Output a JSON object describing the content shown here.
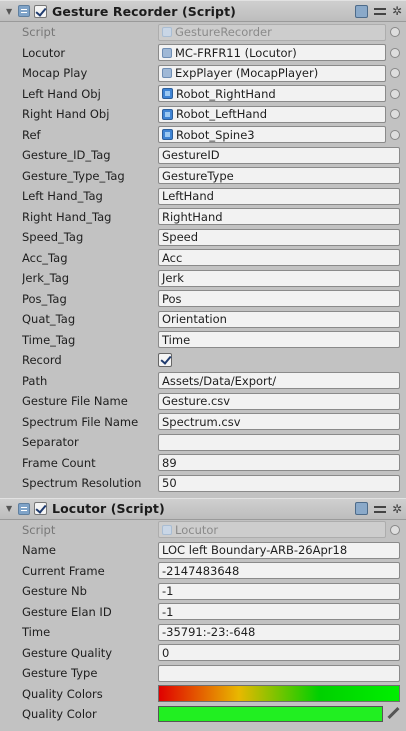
{
  "gesture_recorder": {
    "title": "Gesture Recorder (Script)",
    "script": {
      "label": "Script",
      "value": "GestureRecorder"
    },
    "locutor": {
      "label": "Locutor",
      "value": "MC-FRFR11 (Locutor)"
    },
    "mocap_play": {
      "label": "Mocap Play",
      "value": "ExpPlayer (MocapPlayer)"
    },
    "left_hand_obj": {
      "label": "Left Hand Obj",
      "value": "Robot_RightHand"
    },
    "right_hand_obj": {
      "label": "Right Hand Obj",
      "value": "Robot_LeftHand"
    },
    "ref": {
      "label": "Ref",
      "value": "Robot_Spine3"
    },
    "gesture_id_tag": {
      "label": "Gesture_ID_Tag",
      "value": "GestureID"
    },
    "gesture_type_tag": {
      "label": "Gesture_Type_Tag",
      "value": "GestureType"
    },
    "left_hand_tag": {
      "label": "Left Hand_Tag",
      "value": "LeftHand"
    },
    "right_hand_tag": {
      "label": "Right Hand_Tag",
      "value": "RightHand"
    },
    "speed_tag": {
      "label": "Speed_Tag",
      "value": "Speed"
    },
    "acc_tag": {
      "label": "Acc_Tag",
      "value": "Acc"
    },
    "jerk_tag": {
      "label": "Jerk_Tag",
      "value": "Jerk"
    },
    "pos_tag": {
      "label": "Pos_Tag",
      "value": "Pos"
    },
    "quat_tag": {
      "label": "Quat_Tag",
      "value": "Orientation"
    },
    "time_tag": {
      "label": "Time_Tag",
      "value": "Time"
    },
    "record": {
      "label": "Record",
      "checked": true
    },
    "path": {
      "label": "Path",
      "value": "Assets/Data/Export/"
    },
    "gesture_file_name": {
      "label": "Gesture File Name",
      "value": "Gesture.csv"
    },
    "spectrum_file_name": {
      "label": "Spectrum File Name",
      "value": "Spectrum.csv"
    },
    "separator": {
      "label": "Separator",
      "value": ""
    },
    "frame_count": {
      "label": "Frame Count",
      "value": "89"
    },
    "spectrum_resolution": {
      "label": "Spectrum Resolution",
      "value": "50"
    }
  },
  "locutor": {
    "title": "Locutor (Script)",
    "script": {
      "label": "Script",
      "value": "Locutor"
    },
    "name": {
      "label": "Name",
      "value": "LOC left Boundary-ARB-26Apr18"
    },
    "current_frame": {
      "label": "Current Frame",
      "value": "-2147483648"
    },
    "gesture_nb": {
      "label": "Gesture Nb",
      "value": "-1"
    },
    "gesture_elan_id": {
      "label": "Gesture Elan ID",
      "value": "-1"
    },
    "time": {
      "label": "Time",
      "value": "-35791:-23:-648"
    },
    "gesture_quality": {
      "label": "Gesture Quality",
      "value": "0"
    },
    "gesture_type": {
      "label": "Gesture Type",
      "value": ""
    },
    "quality_colors": {
      "label": "Quality Colors",
      "gradient": [
        "#e00000",
        "#e8b800",
        "#00d000",
        "#00f000"
      ]
    },
    "quality_color": {
      "label": "Quality Color",
      "color": "#21ef21"
    }
  }
}
